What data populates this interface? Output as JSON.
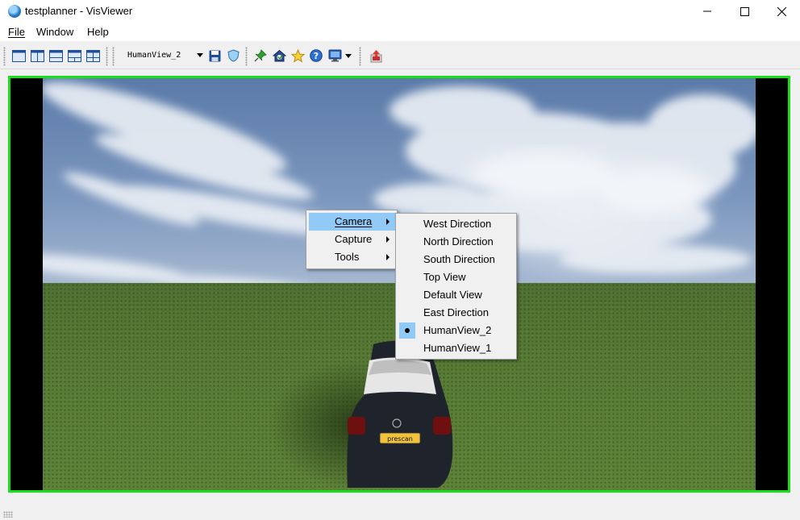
{
  "window": {
    "title": "testplanner - VisViewer"
  },
  "menubar": {
    "items": [
      "File",
      "Window",
      "Help"
    ]
  },
  "toolbar": {
    "layout_buttons": [
      "single-view-icon",
      "two-column-view-icon",
      "two-row-view-icon",
      "three-pane-view-icon",
      "four-pane-view-icon"
    ],
    "view_selector": {
      "value": "HumanView_2"
    },
    "action_icons": [
      "save-icon",
      "shield-icon",
      "pin-icon",
      "home-view-icon",
      "star-icon",
      "help-icon",
      "monitor-icon",
      "record-icon"
    ]
  },
  "context_menu": {
    "items": [
      {
        "label": "Camera",
        "has_submenu": true,
        "highlighted": true
      },
      {
        "label": "Capture",
        "has_submenu": true,
        "highlighted": false
      },
      {
        "label": "Tools",
        "has_submenu": true,
        "highlighted": false
      }
    ]
  },
  "camera_submenu": {
    "items": [
      {
        "label": "West Direction",
        "checked": false
      },
      {
        "label": "North Direction",
        "checked": false
      },
      {
        "label": "South Direction",
        "checked": false
      },
      {
        "label": "Top View",
        "checked": false
      },
      {
        "label": "Default View",
        "checked": false
      },
      {
        "label": "East Direction",
        "checked": false
      },
      {
        "label": "HumanView_2",
        "checked": true
      },
      {
        "label": "HumanView_1",
        "checked": false
      }
    ]
  },
  "scene": {
    "license_plate": "prescan",
    "frame_color": "#18e018"
  }
}
